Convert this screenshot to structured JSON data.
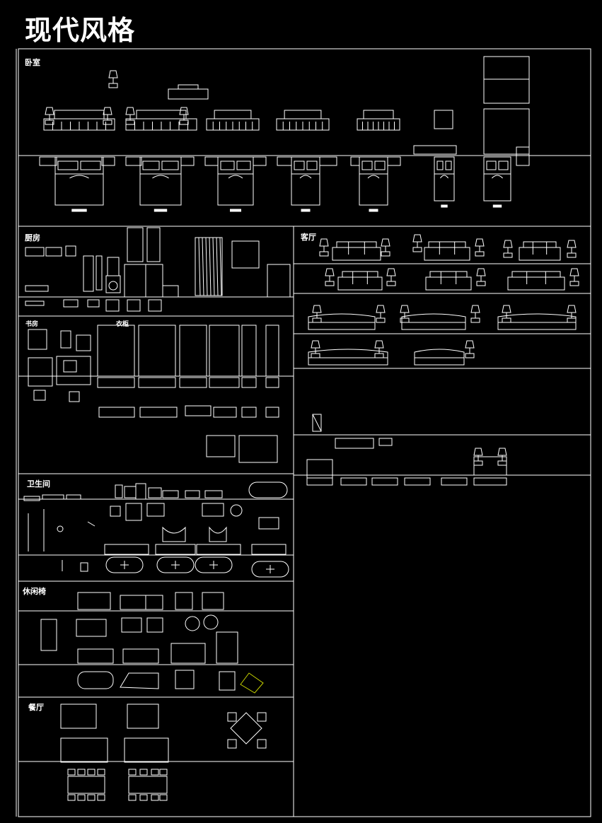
{
  "title": "现代风格",
  "sections": {
    "bedroom": "卧室",
    "kitchen": "厨房",
    "study": "书房",
    "wardrobe": "衣柜",
    "bathroom": "卫生间",
    "lounge_chair": "休闲椅",
    "dining": "餐厅",
    "living": "客厅"
  },
  "colors": {
    "background": "#000000",
    "lines": "#ffffff",
    "accent": "#c8d400"
  }
}
